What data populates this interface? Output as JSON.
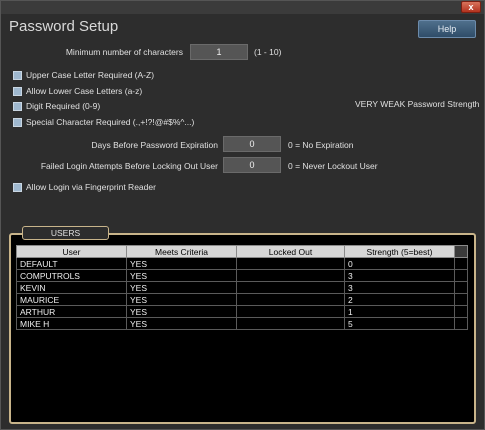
{
  "window": {
    "title": "Password Setup",
    "close_label": "x",
    "help_label": "Help"
  },
  "settings": {
    "min_chars_label": "Minimum number of characters",
    "min_chars_value": "1",
    "min_chars_range": "(1 - 10)",
    "upper_label": "Upper Case Letter Required (A-Z)",
    "lower_label": "Allow Lower Case Letters (a-z)",
    "digit_label": "Digit Required (0-9)",
    "special_label": "Special Character Required (.,+!?!@#$%^...)",
    "strength_text": "VERY WEAK Password Strength",
    "days_label": "Days Before Password Expiration",
    "days_value": "0",
    "days_note": "0 = No Expiration",
    "failed_label": "Failed Login Attempts Before Locking Out User",
    "failed_value": "0",
    "failed_note": "0 = Never Lockout User",
    "fingerprint_label": "Allow Login via Fingerprint Reader"
  },
  "users": {
    "legend": "USERS",
    "columns": [
      "User",
      "Meets Criteria",
      "Locked Out",
      "Strength (5=best)"
    ],
    "rows": [
      [
        "DEFAULT",
        "YES",
        "",
        "0"
      ],
      [
        "COMPUTROLS",
        "YES",
        "",
        "3"
      ],
      [
        "KEVIN",
        "YES",
        "",
        "3"
      ],
      [
        "MAURICE",
        "YES",
        "",
        "2"
      ],
      [
        "ARTHUR",
        "YES",
        "",
        "1"
      ],
      [
        "MIKE H",
        "YES",
        "",
        "5"
      ]
    ]
  }
}
